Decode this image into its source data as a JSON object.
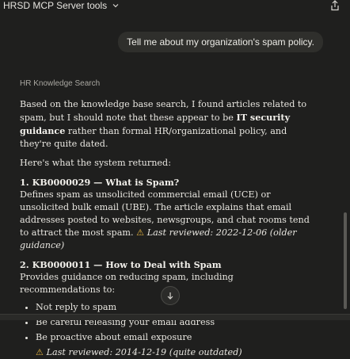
{
  "header": {
    "title": "HRSD MCP Server tools",
    "title_chevron_icon": "chevron-down-icon",
    "share_icon": "share-icon"
  },
  "user_message": "Tell me about my organization's spam policy.",
  "assistant": {
    "source_label": "HR Knowledge Search",
    "intro_1": "Based on the knowledge base search, I found articles related to spam, but I should note that these appear to be ",
    "intro_bold": "IT security guidance",
    "intro_2": " rather than formal HR/organizational policy, and they're quite dated.",
    "returned_label": "Here's what the system returned:",
    "entries": [
      {
        "title": "1. KB0000029 — What is Spam?",
        "body": "Defines spam as unsolicited commercial email (UCE) or unsolicited bulk email (UBE). The article explains that email addresses posted to websites, newsgroups, and chat rooms tend to attract the most spam. ",
        "warning_icon": "⚠",
        "review": "Last reviewed: 2022-12-06 (older guidance)"
      },
      {
        "title": "2. KB0000011 — How to Deal with Spam",
        "body": "Provides guidance on reducing spam, including recommendations to:",
        "bullets": [
          "Not reply to spam",
          "Be careful releasing your email address",
          "Be proactive about email exposure"
        ],
        "warning_icon": "⚠",
        "review": "Last reviewed: 2014-12-19 (quite outdated)"
      }
    ]
  },
  "scroll_button_icon": "arrow-down-icon",
  "colors": {
    "background": "#1f1f1e",
    "bubble": "#2f2f2c",
    "warning": "#e3b341"
  }
}
